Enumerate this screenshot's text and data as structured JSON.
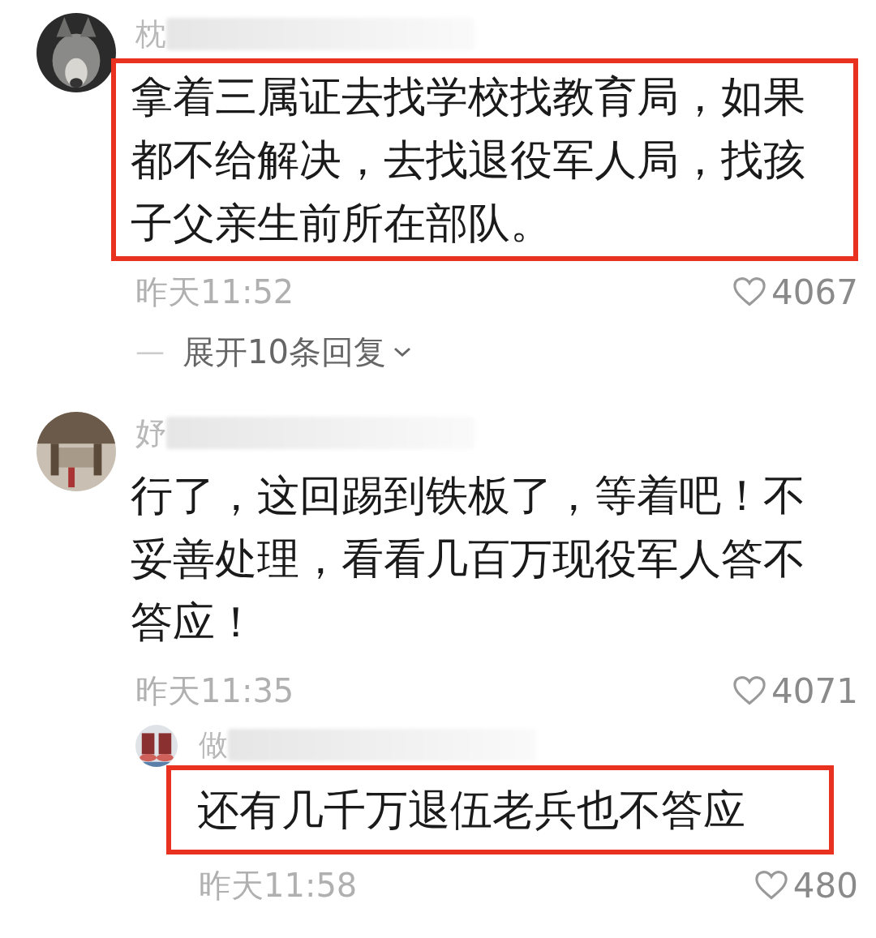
{
  "comments": [
    {
      "username": "枕",
      "text": "拿着三属证去找学校找教育局，如果都不给解决，去找退役军人局，找孩子父亲生前所在部队。",
      "highlighted": true,
      "time": "昨天11:52",
      "likes": "4067",
      "expand": {
        "dash": "—",
        "label": "展开10条回复"
      }
    },
    {
      "username": "妤",
      "text": "行了，这回踢到铁板了，等着吧！不妥善处理，看看几百万现役军人答不答应！",
      "highlighted": false,
      "time": "昨天11:35",
      "likes": "4071",
      "replies": [
        {
          "username": "做",
          "text": "还有几千万退伍老兵也不答应",
          "highlighted": true,
          "time": "昨天11:58",
          "likes": "480"
        }
      ]
    }
  ]
}
